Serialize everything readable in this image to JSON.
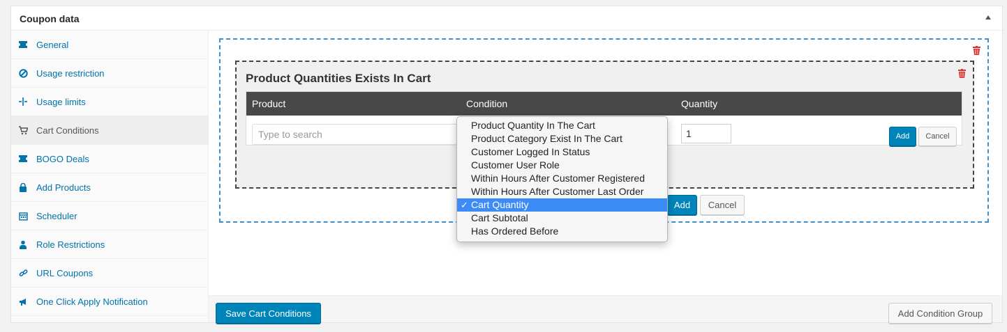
{
  "panel": {
    "title": "Coupon data"
  },
  "sidebar": {
    "items": [
      {
        "label": "General",
        "icon": "ticket-icon"
      },
      {
        "label": "Usage restriction",
        "icon": "block-icon"
      },
      {
        "label": "Usage limits",
        "icon": "limits-icon"
      },
      {
        "label": "Cart Conditions",
        "icon": "cart-icon"
      },
      {
        "label": "BOGO Deals",
        "icon": "ticket-icon"
      },
      {
        "label": "Add Products",
        "icon": "bag-icon"
      },
      {
        "label": "Scheduler",
        "icon": "calendar-icon"
      },
      {
        "label": "Role Restrictions",
        "icon": "user-icon"
      },
      {
        "label": "URL Coupons",
        "icon": "link-icon"
      },
      {
        "label": "One Click Apply Notification",
        "icon": "megaphone-icon"
      }
    ],
    "active_index": 3
  },
  "condition": {
    "title": "Product Quantities Exists In Cart",
    "columns": {
      "product": "Product",
      "condition": "Condition",
      "quantity": "Quantity"
    },
    "search_placeholder": "Type to search",
    "quantity_value": "1",
    "add_label": "Add",
    "cancel_label": "Cancel"
  },
  "group_actions": {
    "add_label": "Add",
    "cancel_label": "Cancel"
  },
  "dropdown": {
    "options": [
      "Product Quantity In The Cart",
      "Product Category Exist In The Cart",
      "Customer Logged In Status",
      "Customer User Role",
      "Within Hours After Customer Registered",
      "Within Hours After Customer Last Order",
      "Cart Quantity",
      "Cart Subtotal",
      "Has Ordered Before"
    ],
    "selected": "Cart Quantity",
    "check": "✓"
  },
  "footer": {
    "save_label": "Save Cart Conditions",
    "add_group_label": "Add Condition Group"
  },
  "colors": {
    "primary": "#0085ba",
    "link": "#0073aa",
    "danger": "#dc3232",
    "selected_option": "#3d8cf5"
  }
}
